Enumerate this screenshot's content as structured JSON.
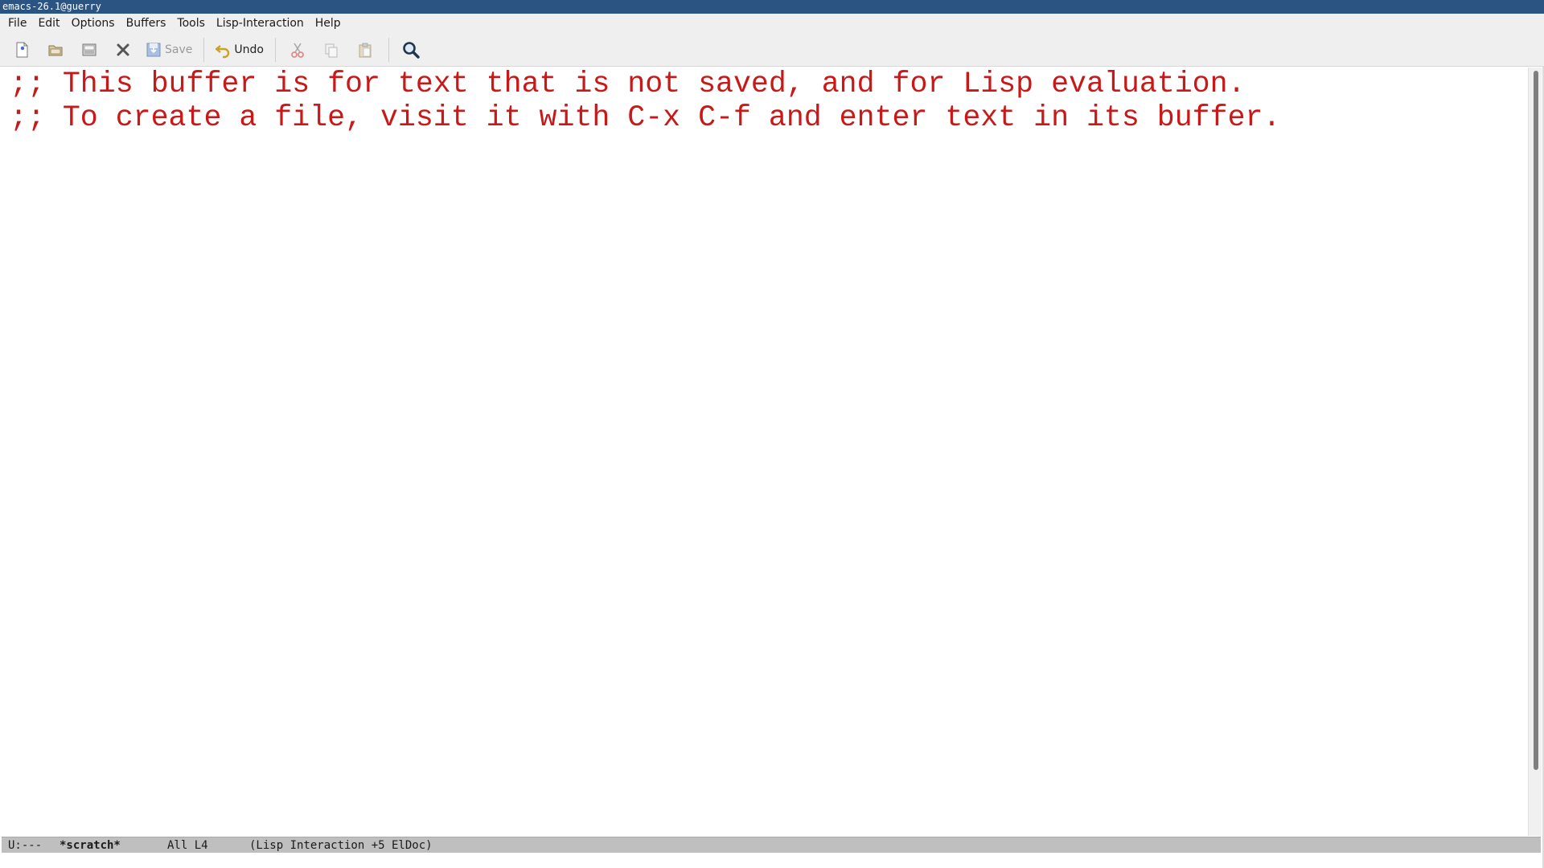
{
  "window": {
    "title": "emacs-26.1@guerry"
  },
  "menubar": {
    "items": [
      "File",
      "Edit",
      "Options",
      "Buffers",
      "Tools",
      "Lisp-Interaction",
      "Help"
    ]
  },
  "toolbar": {
    "save_label": "Save",
    "undo_label": "Undo"
  },
  "buffer": {
    "lines": [
      ";; This buffer is for text that is not saved, and for Lisp evaluation.",
      ";; To create a file, visit it with C-x C-f and enter text in its buffer."
    ],
    "text_color": "#c81818"
  },
  "modeline": {
    "status": "U:---",
    "buffer_name": "*scratch*",
    "position": "All L4",
    "modes": "(Lisp Interaction +5 ElDoc)"
  },
  "colors": {
    "titlebar": "#2b5483",
    "comment": "#c81818",
    "modeline": "#bfbfbf"
  },
  "icons": {
    "new_file": "new-file-icon",
    "open": "open-folder-icon",
    "dired": "dired-icon",
    "close": "close-icon",
    "save": "save-icon",
    "undo": "undo-icon",
    "cut": "cut-icon",
    "copy": "copy-icon",
    "paste": "paste-icon",
    "search": "search-icon"
  }
}
